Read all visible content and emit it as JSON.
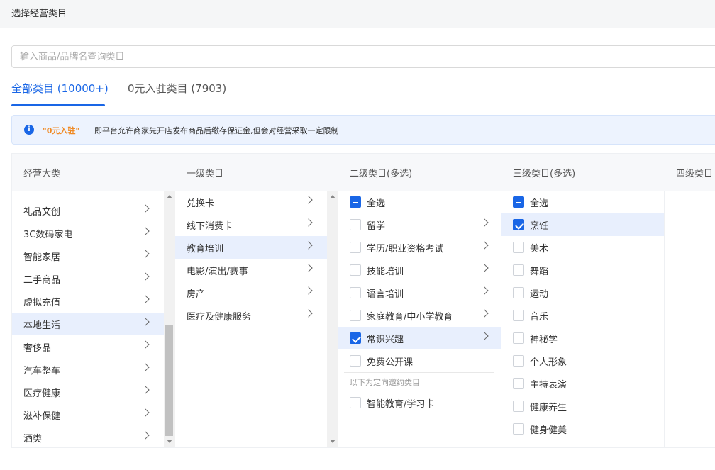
{
  "header": {
    "title": "选择经营类目"
  },
  "search": {
    "placeholder": "输入商品/品牌名查询类目"
  },
  "tabs": [
    {
      "label": "全部类目 (10000+)",
      "active": true
    },
    {
      "label": "0元入驻类目 (7903)",
      "active": false
    }
  ],
  "notice": {
    "icon": "info-icon",
    "highlight": "\"0元入驻\"",
    "text": "即平台允许商家先开店发布商品后缴存保证金,但会对经营采取一定限制"
  },
  "columns": {
    "headers": [
      "经营大类",
      "一级类目",
      "二级类目(多选)",
      "三级类目(多选)",
      "四级类目"
    ]
  },
  "business": {
    "items": [
      {
        "label": "礼品文创"
      },
      {
        "label": "3C数码家电"
      },
      {
        "label": "智能家居"
      },
      {
        "label": "二手商品"
      },
      {
        "label": "虚拟充值"
      },
      {
        "label": "本地生活",
        "selected": true
      },
      {
        "label": "奢侈品"
      },
      {
        "label": "汽车整车"
      },
      {
        "label": "医疗健康"
      },
      {
        "label": "滋补保健"
      },
      {
        "label": "酒类"
      }
    ]
  },
  "level1": {
    "items": [
      {
        "label": "兑换卡"
      },
      {
        "label": "线下消费卡"
      },
      {
        "label": "教育培训",
        "selected": true
      },
      {
        "label": "电影/演出/赛事"
      },
      {
        "label": "房产"
      },
      {
        "label": "医疗及健康服务"
      }
    ]
  },
  "level2": {
    "select_all": "全选",
    "items": [
      {
        "label": "留学",
        "checked": false
      },
      {
        "label": "学历/职业资格考试",
        "checked": false
      },
      {
        "label": "技能培训",
        "checked": false
      },
      {
        "label": "语言培训",
        "checked": false
      },
      {
        "label": "家庭教育/中小学教育",
        "checked": false
      },
      {
        "label": "常识兴趣",
        "checked": true,
        "selected": true
      },
      {
        "label": "免费公开课",
        "checked": false
      }
    ],
    "invite_heading": "以下为定向邀约类目",
    "invite_items": [
      {
        "label": "智能教育/学习卡",
        "checked": false
      }
    ]
  },
  "level3": {
    "select_all": "全选",
    "items": [
      {
        "label": "烹饪",
        "checked": true
      },
      {
        "label": "美术",
        "checked": false
      },
      {
        "label": "舞蹈",
        "checked": false
      },
      {
        "label": "运动",
        "checked": false
      },
      {
        "label": "音乐",
        "checked": false
      },
      {
        "label": "神秘学",
        "checked": false
      },
      {
        "label": "个人形象",
        "checked": false
      },
      {
        "label": "主持表演",
        "checked": false
      },
      {
        "label": "健康养生",
        "checked": false
      },
      {
        "label": "健身健美",
        "checked": false
      }
    ]
  },
  "colors": {
    "accent": "#1966e6",
    "highlight": "#f08a24",
    "selected_row": "#e8effd"
  }
}
